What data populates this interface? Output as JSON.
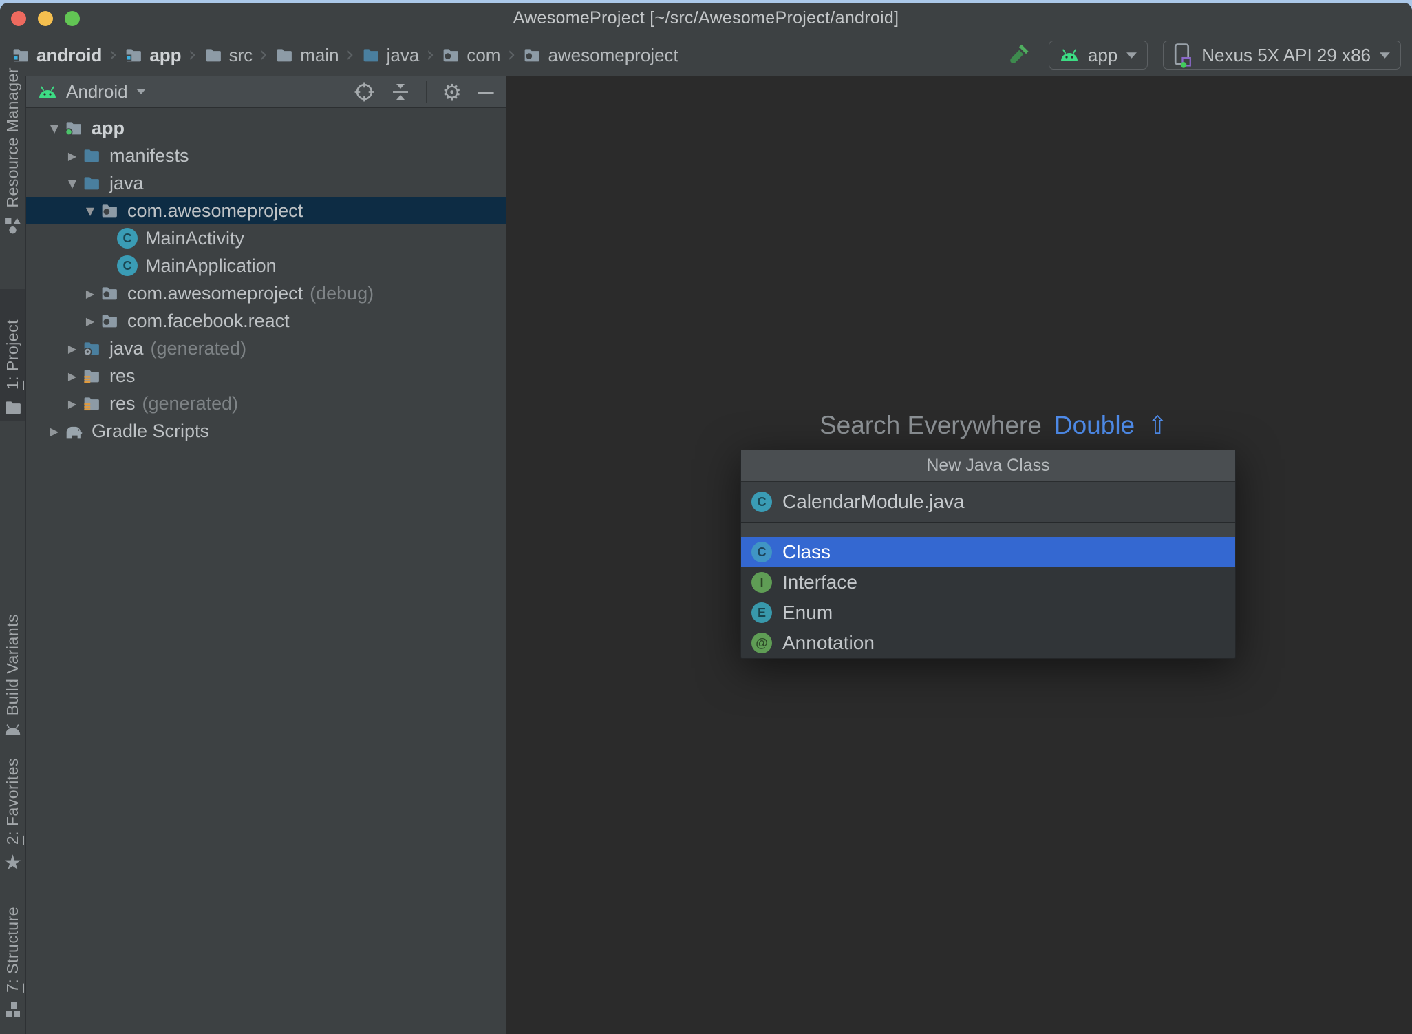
{
  "glyphs": {
    "arrow_down": "▼",
    "arrow_right": "▶",
    "chevron": "›",
    "caret": "▼",
    "gear": "⚙",
    "minus": "—",
    "shift": "⇧",
    "star": "★"
  },
  "colors": {
    "android_green": "#3ddc84",
    "selection_blue": "#3468d1",
    "tree_selection": "#0d2c44",
    "link_blue": "#4f8cea",
    "folder_blue": "#4a7f9f",
    "folder_gray": "#8d9ba6",
    "traffic_red": "#ee6a5f",
    "traffic_yellow": "#f5bf4f",
    "traffic_green": "#62c554"
  },
  "window": {
    "title": "AwesomeProject [~/src/AwesomeProject/android]"
  },
  "breadcrumbs": [
    {
      "label": "android",
      "icon": "folder-module",
      "bold": true
    },
    {
      "label": "app",
      "icon": "folder-module",
      "bold": true
    },
    {
      "label": "src",
      "icon": "folder-gray"
    },
    {
      "label": "main",
      "icon": "folder-gray"
    },
    {
      "label": "java",
      "icon": "folder-blue"
    },
    {
      "label": "com",
      "icon": "package"
    },
    {
      "label": "awesomeproject",
      "icon": "package"
    }
  ],
  "toolbar": {
    "run_config_label": "app",
    "device_label": "Nexus 5X API 29 x86"
  },
  "tool_stripe": [
    {
      "label": "Resource Manager",
      "icon": "resource-manager",
      "active": false
    },
    {
      "shortcut": "1",
      "label": "Project",
      "icon": "project-folder",
      "active": true
    },
    {
      "label": "Build Variants",
      "icon": "build-variants",
      "active": false
    },
    {
      "shortcut": "2",
      "label": "Favorites",
      "icon": "star",
      "active": false
    },
    {
      "shortcut": "7",
      "label": "Structure",
      "icon": "structure",
      "active": false
    }
  ],
  "project_panel": {
    "view_selector": "Android"
  },
  "tree": [
    {
      "level": 0,
      "arrow": "down",
      "icon": "folder-app",
      "label": "app",
      "bold": true
    },
    {
      "level": 1,
      "arrow": "right",
      "icon": "folder-blue",
      "label": "manifests"
    },
    {
      "level": 1,
      "arrow": "down",
      "icon": "folder-blue",
      "label": "java"
    },
    {
      "level": 2,
      "arrow": "down",
      "icon": "package",
      "label": "com.awesomeproject",
      "selected": true
    },
    {
      "level": 3,
      "arrow": "none",
      "icon": "class-badge",
      "label": "MainActivity"
    },
    {
      "level": 3,
      "arrow": "none",
      "icon": "class-badge",
      "label": "MainApplication"
    },
    {
      "level": 2,
      "arrow": "right",
      "icon": "package",
      "label": "com.awesomeproject",
      "suffix": "(debug)"
    },
    {
      "level": 2,
      "arrow": "right",
      "icon": "package",
      "label": "com.facebook.react"
    },
    {
      "level": 1,
      "arrow": "right",
      "icon": "folder-gen",
      "label": "java",
      "suffix": "(generated)"
    },
    {
      "level": 1,
      "arrow": "right",
      "icon": "folder-res",
      "label": "res"
    },
    {
      "level": 1,
      "arrow": "right",
      "icon": "folder-res",
      "label": "res",
      "suffix": "(generated)"
    },
    {
      "level": 0,
      "arrow": "right",
      "icon": "gradle",
      "label": "Gradle Scripts"
    }
  ],
  "editor_hint": {
    "text": "Search Everywhere",
    "shortcut_word": "Double"
  },
  "popup": {
    "title": "New Java Class",
    "file_entry": {
      "letter": "C",
      "color": "#3a9cb5",
      "label": "CalendarModule.java"
    },
    "items": [
      {
        "letter": "C",
        "color": "#4095c4",
        "label": "Class",
        "selected": true
      },
      {
        "letter": "I",
        "color": "#5f9d55",
        "label": "Interface"
      },
      {
        "letter": "E",
        "color": "#3898ab",
        "label": "Enum"
      },
      {
        "letter": "@",
        "color": "#5f9d55",
        "label": "Annotation"
      }
    ]
  }
}
